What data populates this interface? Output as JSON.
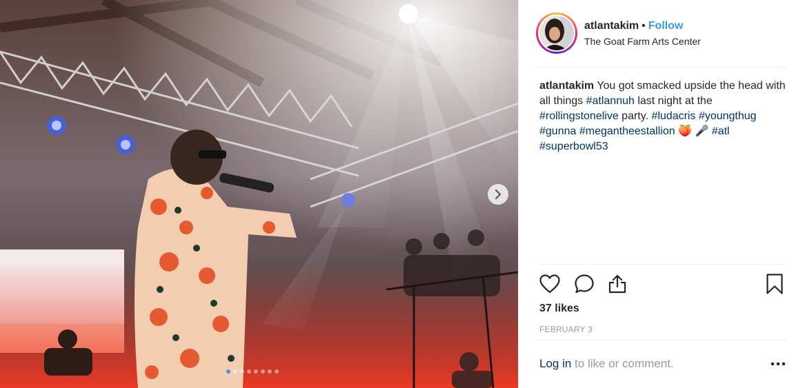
{
  "post": {
    "username": "atlantakim",
    "bullet": "•",
    "follow_label": "Follow",
    "location": "The Goat Farm Arts Center",
    "caption": {
      "username": "atlantakim",
      "text1": " You got smacked upside the head with all things ",
      "tag_atlannuh": "#atlannuh",
      "text2": " last night at the ",
      "tag_rollingstonelive": "#rollingstonelive",
      "text3": " party. ",
      "tag_ludacris": "#ludacris",
      "tag_youngthug": "#youngthug",
      "tag_gunna": "#gunna",
      "tag_megantheestallion": "#megantheestallion",
      "emoji_peach": "🍑",
      "emoji_mic": "🎤",
      "tag_atl": "#atl",
      "tag_superbowl53": "#superbowl53"
    },
    "likes": "37 likes",
    "date": "FEBRUARY 3",
    "comment_login": "Log in",
    "comment_rest": " to like or comment.",
    "carousel": {
      "total": 8,
      "active_index": 0
    }
  },
  "colors": {
    "follow": "#3897f0",
    "hashtag": "#003569",
    "muted": "#999999",
    "text": "#262626",
    "divider": "#efefef"
  },
  "icons": {
    "like": "heart-icon",
    "comment": "comment-bubble-icon",
    "share": "share-icon",
    "save": "bookmark-icon",
    "more": "more-options-icon",
    "next": "chevron-right-icon"
  }
}
